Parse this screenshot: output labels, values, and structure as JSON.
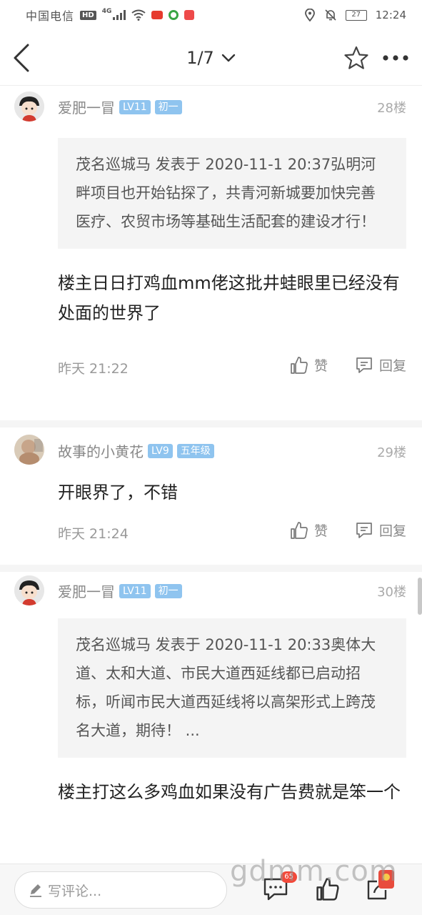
{
  "status_bar": {
    "carrier": "中国电信",
    "hd": "HD",
    "network": "4G",
    "battery": "27",
    "time": "12:24"
  },
  "nav": {
    "page_indicator": "1/7"
  },
  "posts": [
    {
      "username": "爱肥一冒",
      "level": "LV11",
      "rank": "初一",
      "floor": "28楼",
      "quote": "茂名巡城马 发表于 2020-11-1 20:37弘明河畔项目也开始钻探了，共青河新城要加快完善医疗、农贸市场等基础生活配套的建设才行！",
      "content": "楼主日日打鸡血mm佬这批井蛙眼里已经没有处面的世界了",
      "time": "昨天 21:22",
      "like_label": "赞",
      "reply_label": "回复"
    },
    {
      "username": "故事的小黄花",
      "level": "LV9",
      "rank": "五年级",
      "floor": "29楼",
      "content": "开眼界了，不错",
      "time": "昨天 21:24",
      "like_label": "赞",
      "reply_label": "回复"
    },
    {
      "username": "爱肥一冒",
      "level": "LV11",
      "rank": "初一",
      "floor": "30楼",
      "quote": "茂名巡城马 发表于 2020-11-1 20:33奥体大道、太和大道、市民大道西延线都已启动招标，听闻市民大道西延线将以高架形式上跨茂名大道，期待！ ...",
      "content": "楼主打这么多鸡血如果没有广告费就是笨一个"
    }
  ],
  "bottom_bar": {
    "comment_placeholder": "写评论...",
    "comment_count": "65"
  },
  "watermark": "gdmm.com",
  "colors": {
    "level_badge": "#8fc4ef",
    "count_badge": "#f2493a"
  }
}
